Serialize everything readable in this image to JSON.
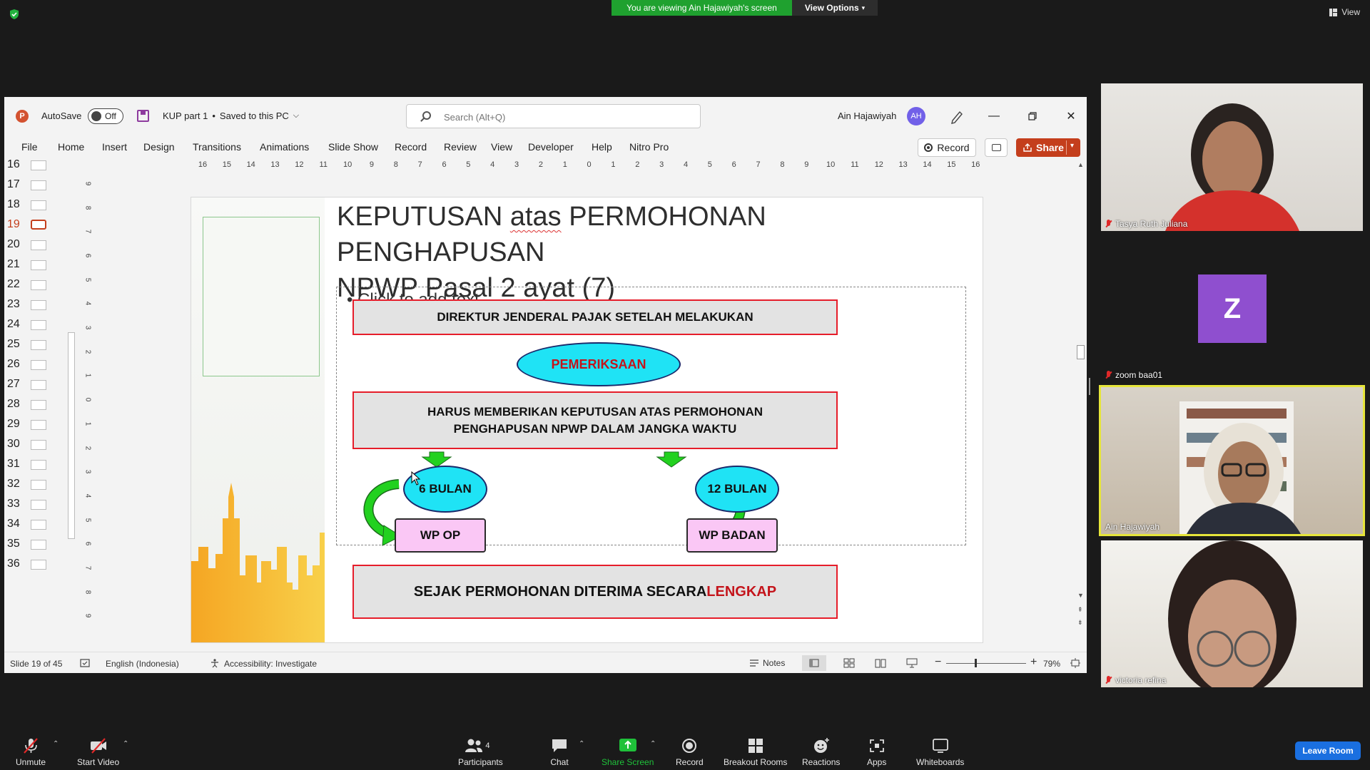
{
  "zoom": {
    "viewing_banner": "You are viewing Ain Hajawiyah's screen",
    "view_options": "View Options",
    "view_label": "View",
    "leave": "Leave Room",
    "toolbar": {
      "unmute": "Unmute",
      "start_video": "Start Video",
      "participants": "Participants",
      "participants_count": "4",
      "chat": "Chat",
      "share_screen": "Share Screen",
      "record": "Record",
      "breakout": "Breakout Rooms",
      "reactions": "Reactions",
      "apps": "Apps",
      "whiteboards": "Whiteboards"
    },
    "participants": [
      {
        "name": "Tasya Ruth Juliana"
      },
      {
        "name": "zoom baa01",
        "initial": "Z"
      },
      {
        "name": "Ain Hajawiyah"
      },
      {
        "name": "victoria refina"
      }
    ]
  },
  "ppt": {
    "logo": "P",
    "autosave_label": "AutoSave",
    "autosave_state": "Off",
    "file_name": "KUP part 1",
    "save_status": "Saved to this PC",
    "search_placeholder": "Search (Alt+Q)",
    "user_name": "Ain Hajawiyah",
    "user_initials": "AH",
    "tabs": [
      "File",
      "Home",
      "Insert",
      "Design",
      "Transitions",
      "Animations",
      "Slide Show",
      "Record",
      "Review",
      "View",
      "Developer",
      "Help",
      "Nitro Pro"
    ],
    "record_button": "Record",
    "share_button": "Share",
    "slide_numbers": [
      "16",
      "17",
      "18",
      "19",
      "20",
      "21",
      "22",
      "23",
      "24",
      "25",
      "26",
      "27",
      "28",
      "29",
      "30",
      "31",
      "32",
      "33",
      "34",
      "35",
      "36"
    ],
    "active_slide": "19",
    "hruler_labels": [
      "16",
      "15",
      "14",
      "13",
      "12",
      "11",
      "10",
      "9",
      "8",
      "7",
      "6",
      "5",
      "4",
      "3",
      "2",
      "1",
      "0",
      "1",
      "2",
      "3",
      "4",
      "5",
      "6",
      "7",
      "8",
      "9",
      "10",
      "11",
      "12",
      "13",
      "14",
      "15",
      "16"
    ],
    "vruler_labels": [
      "9",
      "8",
      "7",
      "6",
      "5",
      "4",
      "3",
      "2",
      "1",
      "0",
      "1",
      "2",
      "3",
      "4",
      "5",
      "6",
      "7",
      "8",
      "9"
    ],
    "slide": {
      "title_line1_a": "KEPUTUSAN ",
      "title_line1_b": "atas",
      "title_line1_c": " PERMOHONAN PENGHAPUSAN",
      "title_line2_a": "NPWP ",
      "title_line2_b": "Pasal",
      "title_line2_c": " 2 ",
      "title_line2_d": "ayat",
      "title_line2_e": " (7)",
      "bullet_placeholder": "Click to add text",
      "box1": "DIREKTUR JENDERAL PAJAK SETELAH MELAKUKAN",
      "oval1": "PEMERIKSAAN",
      "box2_line1": "HARUS MEMBERIKAN KEPUTUSAN ATAS PERMOHONAN",
      "box2_line2": "PENGHAPUSAN NPWP DALAM JANGKA WAKTU",
      "oval_left": "6 BULAN",
      "oval_right": "12 BULAN",
      "pink_left": "WP OP",
      "pink_right": "WP BADAN",
      "box3_a": "SEJAK PERMOHONAN DITERIMA SECARA ",
      "box3_b": "LENGKAP"
    },
    "status": {
      "slide_of": "Slide 19 of 45",
      "language": "English (Indonesia)",
      "accessibility": "Accessibility: Investigate",
      "notes": "Notes",
      "zoom": "79%"
    },
    "colors": {
      "accent": "#c43e1c",
      "flow_border": "#e61d2a",
      "oval_fill": "#1fe3f5"
    }
  }
}
